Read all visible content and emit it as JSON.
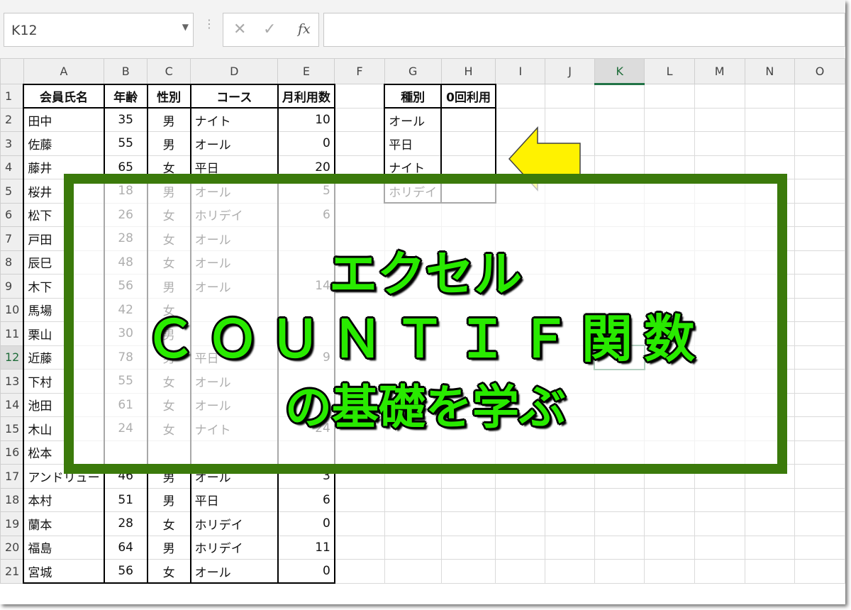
{
  "name_box": "K12",
  "formula_buttons": {
    "cancel": "✕",
    "enter": "✓",
    "fx": "fx"
  },
  "formula_value": "",
  "columns": [
    "A",
    "B",
    "C",
    "D",
    "E",
    "F",
    "G",
    "H",
    "I",
    "J",
    "K",
    "L",
    "M",
    "N",
    "O"
  ],
  "selected_cell": "K12",
  "rows": [
    {
      "n": "1",
      "a": "会員氏名",
      "b": "年齢",
      "c": "性別",
      "d": "コース",
      "e": "月利用数",
      "g": "種別",
      "h": "0回利用"
    },
    {
      "n": "2",
      "a": "田中",
      "b": "35",
      "c": "男",
      "d": "ナイト",
      "e": "10",
      "g": "オール",
      "h": ""
    },
    {
      "n": "3",
      "a": "佐藤",
      "b": "55",
      "c": "男",
      "d": "オール",
      "e": "0",
      "g": "平日",
      "h": ""
    },
    {
      "n": "4",
      "a": "藤井",
      "b": "65",
      "c": "女",
      "d": "平日",
      "e": "20",
      "g": "ナイト",
      "h": ""
    },
    {
      "n": "5",
      "a": "桜井",
      "b": "18",
      "c": "男",
      "d": "オール",
      "e": "5",
      "g": "ホリデイ",
      "h": ""
    },
    {
      "n": "6",
      "a": "松下",
      "b": "26",
      "c": "女",
      "d": "ホリデイ",
      "e": "6"
    },
    {
      "n": "7",
      "a": "戸田",
      "b": "28",
      "c": "女",
      "d": "オール",
      "e": ""
    },
    {
      "n": "8",
      "a": "辰巳",
      "b": "48",
      "c": "女",
      "d": "オール",
      "e": ""
    },
    {
      "n": "9",
      "a": "木下",
      "b": "56",
      "c": "男",
      "d": "オール",
      "e": "14"
    },
    {
      "n": "10",
      "a": "馬場",
      "b": "42",
      "c": "女",
      "d": "",
      "e": ""
    },
    {
      "n": "11",
      "a": "栗山",
      "b": "30",
      "c": "男",
      "d": "",
      "e": ""
    },
    {
      "n": "12",
      "a": "近藤",
      "b": "78",
      "c": "男",
      "d": "平日",
      "e": "9"
    },
    {
      "n": "13",
      "a": "下村",
      "b": "55",
      "c": "女",
      "d": "オール",
      "e": ""
    },
    {
      "n": "14",
      "a": "池田",
      "b": "61",
      "c": "女",
      "d": "オール",
      "e": ""
    },
    {
      "n": "15",
      "a": "木山",
      "b": "24",
      "c": "女",
      "d": "ナイト",
      "e": "24"
    },
    {
      "n": "16",
      "a": "松本",
      "b": "",
      "c": "",
      "d": "",
      "e": ""
    },
    {
      "n": "17",
      "a": "アンドリュー",
      "b": "46",
      "c": "男",
      "d": "オール",
      "e": "3"
    },
    {
      "n": "18",
      "a": "本村",
      "b": "51",
      "c": "男",
      "d": "平日",
      "e": "6"
    },
    {
      "n": "19",
      "a": "蘭本",
      "b": "28",
      "c": "女",
      "d": "ホリデイ",
      "e": "0"
    },
    {
      "n": "20",
      "a": "福島",
      "b": "64",
      "c": "男",
      "d": "ホリデイ",
      "e": "11"
    },
    {
      "n": "21",
      "a": "宮城",
      "b": "56",
      "c": "女",
      "d": "オール",
      "e": "0"
    }
  ],
  "overlay": {
    "line1": "エクセル",
    "line2": "ＣＯＵＮＴＩＦ関数",
    "line3": "の基礎を学ぶ"
  },
  "colors": {
    "overlay_text": "#29ea00",
    "overlay_border": "#3b7a0b",
    "arrow": "#fff200",
    "selection": "#217346"
  },
  "icons": [
    "dropdown-arrow-icon",
    "cancel-icon",
    "enter-check-icon",
    "function-icon",
    "left-arrow-icon"
  ]
}
